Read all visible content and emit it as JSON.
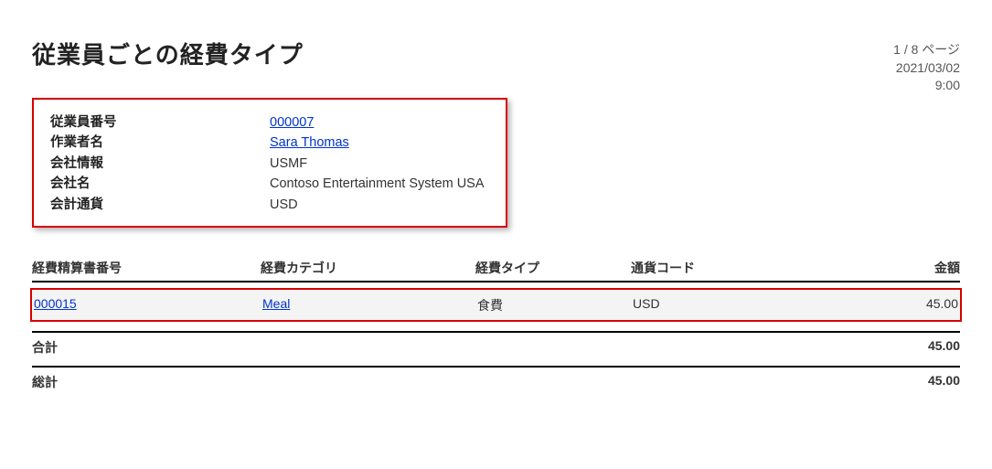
{
  "header": {
    "title": "従業員ごとの経費タイプ",
    "page_indicator": "1 / 8 ページ",
    "date": "2021/03/02",
    "time": "9:00"
  },
  "info": {
    "labels": {
      "employee_no": "従業員番号",
      "worker_name": "作業者名",
      "company_info": "会社情報",
      "company_name": "会社名",
      "accounting_currency": "会計通貨"
    },
    "values": {
      "employee_no": "000007",
      "worker_name": "Sara Thomas",
      "company_info": "USMF",
      "company_name": "Contoso Entertainment System USA",
      "accounting_currency": "USD"
    }
  },
  "table": {
    "columns": {
      "report_no": "経費精算書番号",
      "category": "経費カテゴリ",
      "type": "経費タイプ",
      "currency": "通貨コード",
      "amount": "金額"
    },
    "row": {
      "report_no": "000015",
      "category": "Meal",
      "type": "食費",
      "currency": "USD",
      "amount": "45.00"
    },
    "subtotal_label": "合計",
    "subtotal_value": "45.00",
    "grand_label": "総計",
    "grand_value": "45.00"
  }
}
